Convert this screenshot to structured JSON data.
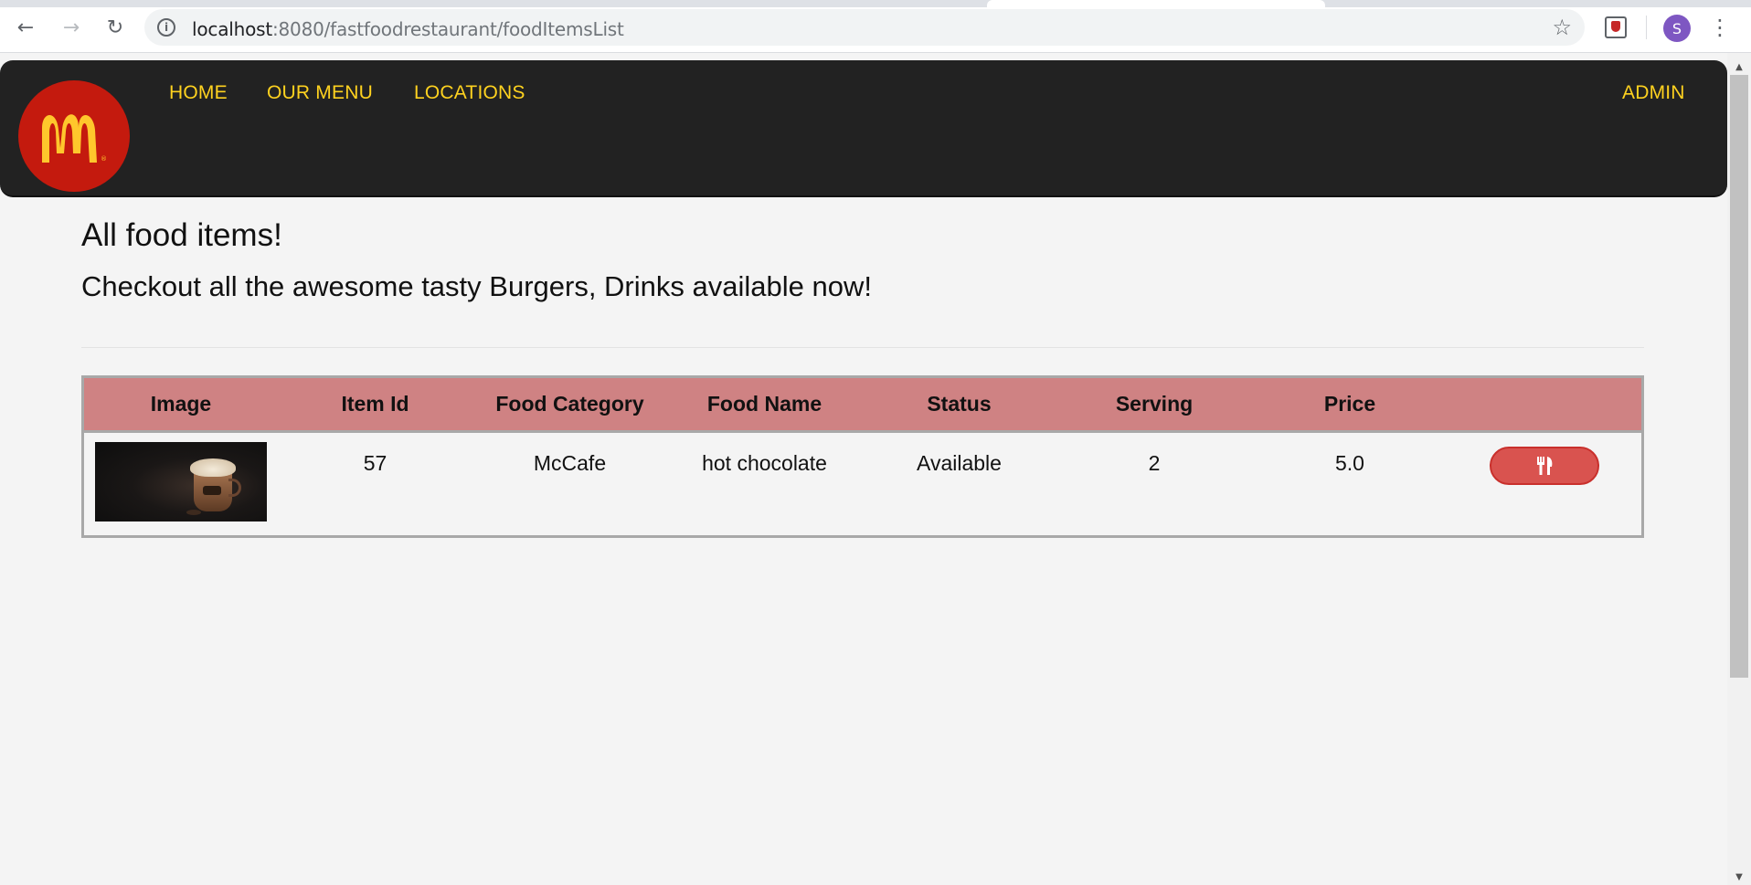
{
  "browser": {
    "back_icon": "arrow-left-icon",
    "forward_icon": "arrow-right-icon",
    "reload_icon": "reload-icon",
    "url_host": "localhost",
    "url_path": ":8080/fastfoodrestaurant/foodItemsList",
    "profile_initial": "S"
  },
  "header": {
    "logo": "mcdonalds-logo",
    "nav": {
      "home": "HOME",
      "menu": "OUR MENU",
      "locations": "LOCATIONS",
      "admin": "ADMIN"
    },
    "nav_color": "#ffd21f",
    "bg_color": "#222222"
  },
  "page": {
    "title": "All food items!",
    "subtitle": "Checkout all the awesome tasty Burgers, Drinks available now!"
  },
  "table": {
    "header_bg": "#cf8283",
    "columns": {
      "image": "Image",
      "item_id": "Item Id",
      "food_category": "Food Category",
      "food_name": "Food Name",
      "status": "Status",
      "serving": "Serving",
      "price": "Price"
    },
    "rows": [
      {
        "image": "hot-chocolate-image",
        "item_id": "57",
        "food_category": "McCafe",
        "food_name": "hot chocolate",
        "status": "Available",
        "serving": "2",
        "price": "5.0",
        "action_icon": "cutlery-icon",
        "action_color": "#d9534f"
      }
    ]
  }
}
